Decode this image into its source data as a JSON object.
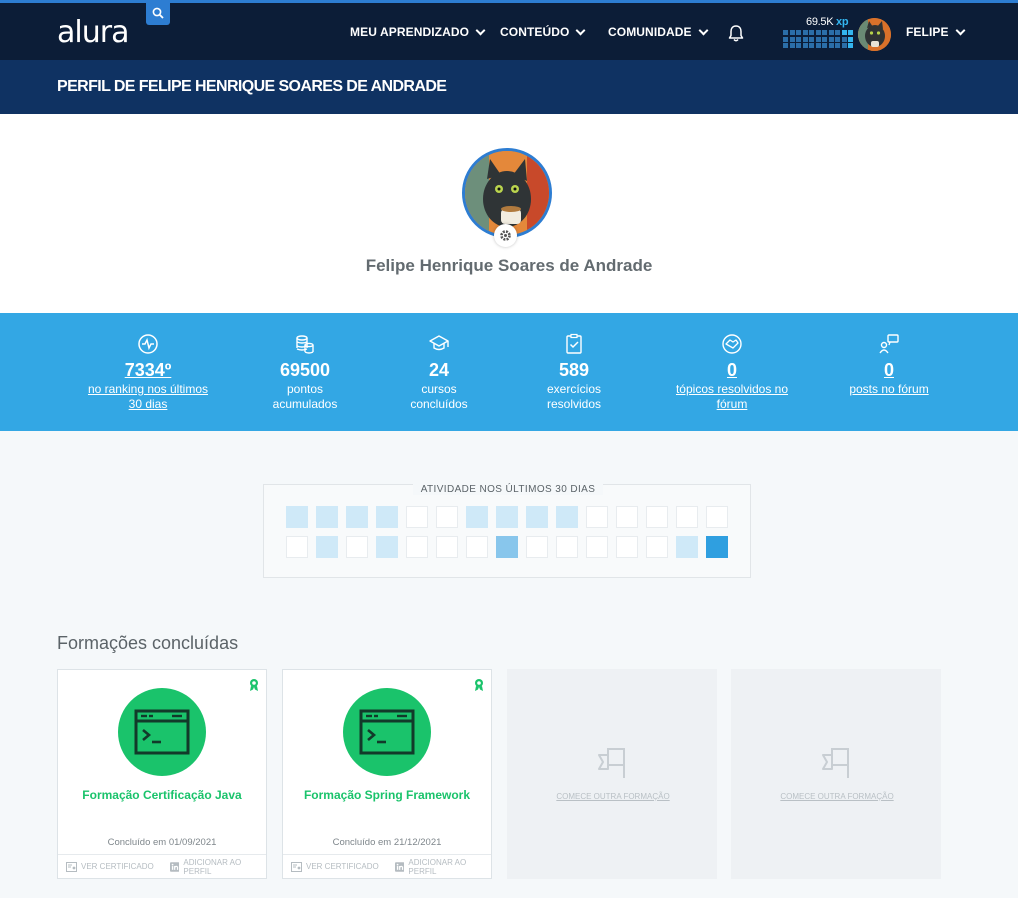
{
  "nav": {
    "logo": "alura",
    "items": [
      {
        "label": "MEU APRENDIZADO"
      },
      {
        "label": "CONTEÚDO"
      },
      {
        "label": "COMUNIDADE"
      }
    ],
    "xp_value": "69.5K",
    "xp_unit": "xp",
    "user_label": "FELIPE"
  },
  "page_title": "PERFIL DE FELIPE HENRIQUE SOARES DE ANDRADE",
  "profile": {
    "name": "Felipe Henrique Soares de Andrade"
  },
  "stats": [
    {
      "icon": "activity-icon",
      "value": "7334º",
      "label": "no ranking nos últimos 30 dias",
      "link": true
    },
    {
      "icon": "coins-icon",
      "value": "69500",
      "label": "pontos acumulados",
      "link": false
    },
    {
      "icon": "graduation-cap-icon",
      "value": "24",
      "label": "cursos concluídos",
      "link": false
    },
    {
      "icon": "clipboard-check-icon",
      "value": "589",
      "label": "exercícios resolvidos",
      "link": false
    },
    {
      "icon": "handshake-icon",
      "value": "0",
      "label": "tópicos resolvidos no fórum",
      "link": true
    },
    {
      "icon": "forum-post-icon",
      "value": "0",
      "label": "posts no fórum",
      "link": true
    }
  ],
  "activity": {
    "title": "ATIVIDADE NOS ÚLTIMOS 30 DIAS",
    "levels": [
      1,
      1,
      1,
      1,
      0,
      0,
      1,
      1,
      1,
      1,
      0,
      0,
      0,
      0,
      0,
      0,
      1,
      0,
      1,
      0,
      0,
      0,
      2,
      0,
      0,
      0,
      0,
      0,
      1,
      3
    ]
  },
  "formacoes": {
    "title": "Formações concluídas",
    "cards": [
      {
        "title": "Formação Certificação Java",
        "date": "Concluído em 01/09/2021",
        "cert_label": "VER CERTIFICADO",
        "profile_label": "ADICIONAR AO PERFIL"
      },
      {
        "title": "Formação Spring Framework",
        "date": "Concluído em 21/12/2021",
        "cert_label": "VER CERTIFICADO",
        "profile_label": "ADICIONAR AO PERFIL"
      }
    ],
    "empty_cards": [
      {
        "label": "COMECE OUTRA FORMAÇÃO"
      },
      {
        "label": "COMECE OUTRA FORMAÇÃO"
      }
    ]
  },
  "colors": {
    "nav_bg": "#0c1d37",
    "title_bar_bg": "#0f3262",
    "stats_bg": "#33a7e4",
    "accent_green": "#1ac36b",
    "accent_blue": "#2d7dd2"
  }
}
